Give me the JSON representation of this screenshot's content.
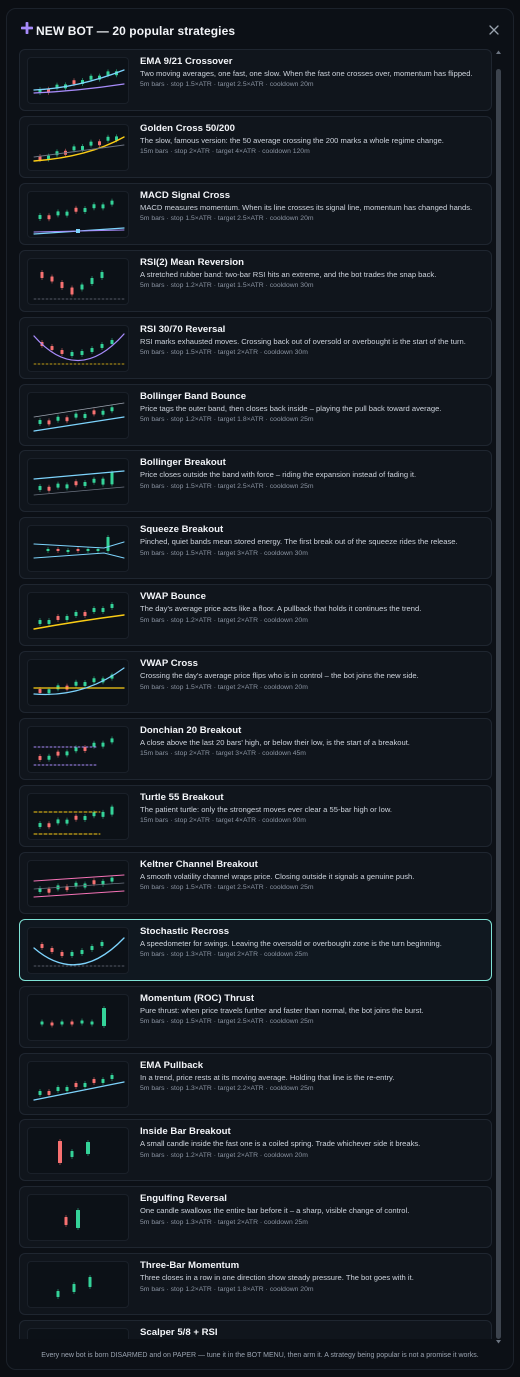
{
  "header": {
    "title": "NEW BOT — 20 popular strategies",
    "accent": "#a78bfa"
  },
  "strategies": [
    {
      "name": "EMA 9/21 Crossover",
      "desc": "Two moving averages, one fast, one slow. When the fast one crosses over, momentum has flipped.",
      "meta": "5m bars · stop 1.5×ATR · target 2.5×ATR · cooldown 20m",
      "thumb": "ema"
    },
    {
      "name": "Golden Cross 50/200",
      "desc": "The slow, famous version: the 50 average crossing the 200 marks a whole regime change.",
      "meta": "15m bars · stop 2×ATR · target 4×ATR · cooldown 120m",
      "thumb": "golden"
    },
    {
      "name": "MACD Signal Cross",
      "desc": "MACD measures momentum. When its line crosses its signal line, momentum has changed hands.",
      "meta": "5m bars · stop 1.5×ATR · target 2.5×ATR · cooldown 20m",
      "thumb": "macd"
    },
    {
      "name": "RSI(2) Mean Reversion",
      "desc": "A stretched rubber band: two-bar RSI hits an extreme, and the bot trades the snap back.",
      "meta": "5m bars · stop 1.2×ATR · target 1.5×ATR · cooldown 30m",
      "thumb": "rsi2"
    },
    {
      "name": "RSI 30/70 Reversal",
      "desc": "RSI marks exhausted moves. Crossing back out of oversold or overbought is the start of the turn.",
      "meta": "5m bars · stop 1.5×ATR · target 2×ATR · cooldown 30m",
      "thumb": "rsi30"
    },
    {
      "name": "Bollinger Band Bounce",
      "desc": "Price tags the outer band, then closes back inside – playing the pull back toward average.",
      "meta": "5m bars · stop 1.2×ATR · target 1.8×ATR · cooldown 25m",
      "thumb": "bbounce"
    },
    {
      "name": "Bollinger Breakout",
      "desc": "Price closes outside the band with force – riding the expansion instead of fading it.",
      "meta": "5m bars · stop 1.5×ATR · target 2.5×ATR · cooldown 25m",
      "thumb": "bbreak"
    },
    {
      "name": "Squeeze Breakout",
      "desc": "Pinched, quiet bands mean stored energy. The first break out of the squeeze rides the release.",
      "meta": "5m bars · stop 1.5×ATR · target 3×ATR · cooldown 30m",
      "thumb": "squeeze"
    },
    {
      "name": "VWAP Bounce",
      "desc": "The day's average price acts like a floor. A pullback that holds it continues the trend.",
      "meta": "5m bars · stop 1.2×ATR · target 2×ATR · cooldown 20m",
      "thumb": "vwapb"
    },
    {
      "name": "VWAP Cross",
      "desc": "Crossing the day's average price flips who is in control – the bot joins the new side.",
      "meta": "5m bars · stop 1.5×ATR · target 2×ATR · cooldown 20m",
      "thumb": "vwapc"
    },
    {
      "name": "Donchian 20 Breakout",
      "desc": "A close above the last 20 bars' high, or below their low, is the start of a breakout.",
      "meta": "15m bars · stop 2×ATR · target 3×ATR · cooldown 45m",
      "thumb": "donchian"
    },
    {
      "name": "Turtle 55 Breakout",
      "desc": "The patient turtle: only the strongest moves ever clear a 55-bar high or low.",
      "meta": "15m bars · stop 2×ATR · target 4×ATR · cooldown 90m",
      "thumb": "turtle"
    },
    {
      "name": "Keltner Channel Breakout",
      "desc": "A smooth volatility channel wraps price. Closing outside it signals a genuine push.",
      "meta": "5m bars · stop 1.5×ATR · target 2.5×ATR · cooldown 25m",
      "thumb": "keltner"
    },
    {
      "name": "Stochastic Recross",
      "desc": "A speedometer for swings. Leaving the oversold or overbought zone is the turn beginning.",
      "meta": "5m bars · stop 1.3×ATR · target 2×ATR · cooldown 25m",
      "thumb": "stoch",
      "selected": true
    },
    {
      "name": "Momentum (ROC) Thrust",
      "desc": "Pure thrust: when price travels further and faster than normal, the bot joins the burst.",
      "meta": "5m bars · stop 1.5×ATR · target 2.5×ATR · cooldown 25m",
      "thumb": "roc"
    },
    {
      "name": "EMA Pullback",
      "desc": "In a trend, price rests at its moving average. Holding that line is the re-entry.",
      "meta": "5m bars · stop 1.3×ATR · target 2.2×ATR · cooldown 25m",
      "thumb": "emapb"
    },
    {
      "name": "Inside Bar Breakout",
      "desc": "A small candle inside the fast one is a coiled spring. Trade whichever side it breaks.",
      "meta": "5m bars · stop 1.2×ATR · target 2×ATR · cooldown 20m",
      "thumb": "inside"
    },
    {
      "name": "Engulfing Reversal",
      "desc": "One candle swallows the entire bar before it – a sharp, visible change of control.",
      "meta": "5m bars · stop 1.3×ATR · target 2×ATR · cooldown 25m",
      "thumb": "engulf"
    },
    {
      "name": "Three-Bar Momentum",
      "desc": "Three closes in a row in one direction show steady pressure. The bot goes with it.",
      "meta": "5m bars · stop 1.2×ATR · target 1.8×ATR · cooldown 20m",
      "thumb": "three"
    },
    {
      "name": "Scalper 5/8 + RSI",
      "desc": "",
      "meta": "",
      "thumb": "scalper"
    }
  ],
  "footer": "Every new bot is born DISARMED and on PAPER — tune it in the BOT MENU, then arm it. A strategy being popular is not a promise it works.",
  "colors": {
    "up": "#34d399",
    "down": "#f87171",
    "accent_line": "#7dd3fc",
    "selected_border": "#7fe3d6",
    "gold": "#facc15",
    "purple": "#a78bfa",
    "pink": "#f472b6"
  }
}
